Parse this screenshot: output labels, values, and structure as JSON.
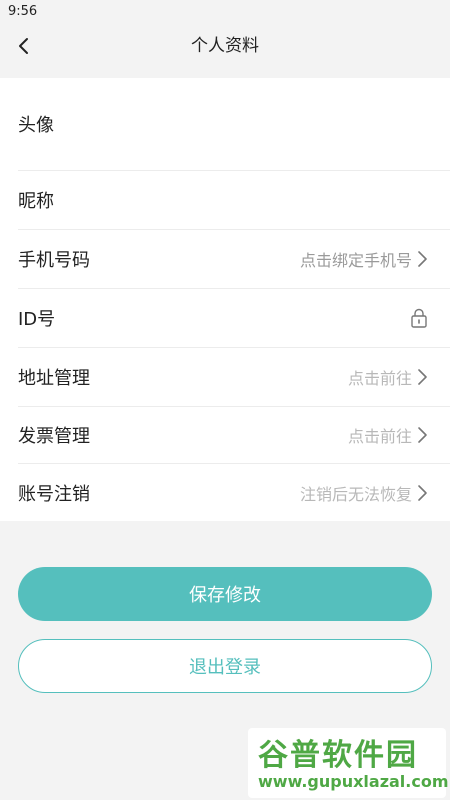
{
  "status_bar": {
    "time": "9:56"
  },
  "header": {
    "title": "个人资料",
    "back_icon": "chevron-left-icon"
  },
  "profile_rows": [
    {
      "id": "avatar",
      "label": "头像",
      "value": "",
      "icon": ""
    },
    {
      "id": "nickname",
      "label": "昵称",
      "value": "",
      "icon": ""
    },
    {
      "id": "phone",
      "label": "手机号码",
      "value": "点击绑定手机号",
      "icon": "chevron-right-icon"
    },
    {
      "id": "id",
      "label": "ID号",
      "value": "",
      "icon": "lock-icon"
    },
    {
      "id": "address",
      "label": "地址管理",
      "value": "点击前往",
      "icon": "chevron-right-icon"
    },
    {
      "id": "invoice",
      "label": "发票管理",
      "value": "点击前往",
      "icon": "chevron-right-icon"
    },
    {
      "id": "cancel-account",
      "label": "账号注销",
      "value": "注销后无法恢复",
      "icon": "chevron-right-icon"
    }
  ],
  "buttons": {
    "save": "保存修改",
    "logout": "退出登录"
  },
  "watermark": {
    "title": "谷普软件园",
    "url": "www.gupuxlazal.com"
  },
  "colors": {
    "accent": "#55bfbd",
    "watermark": "#4fa845"
  }
}
